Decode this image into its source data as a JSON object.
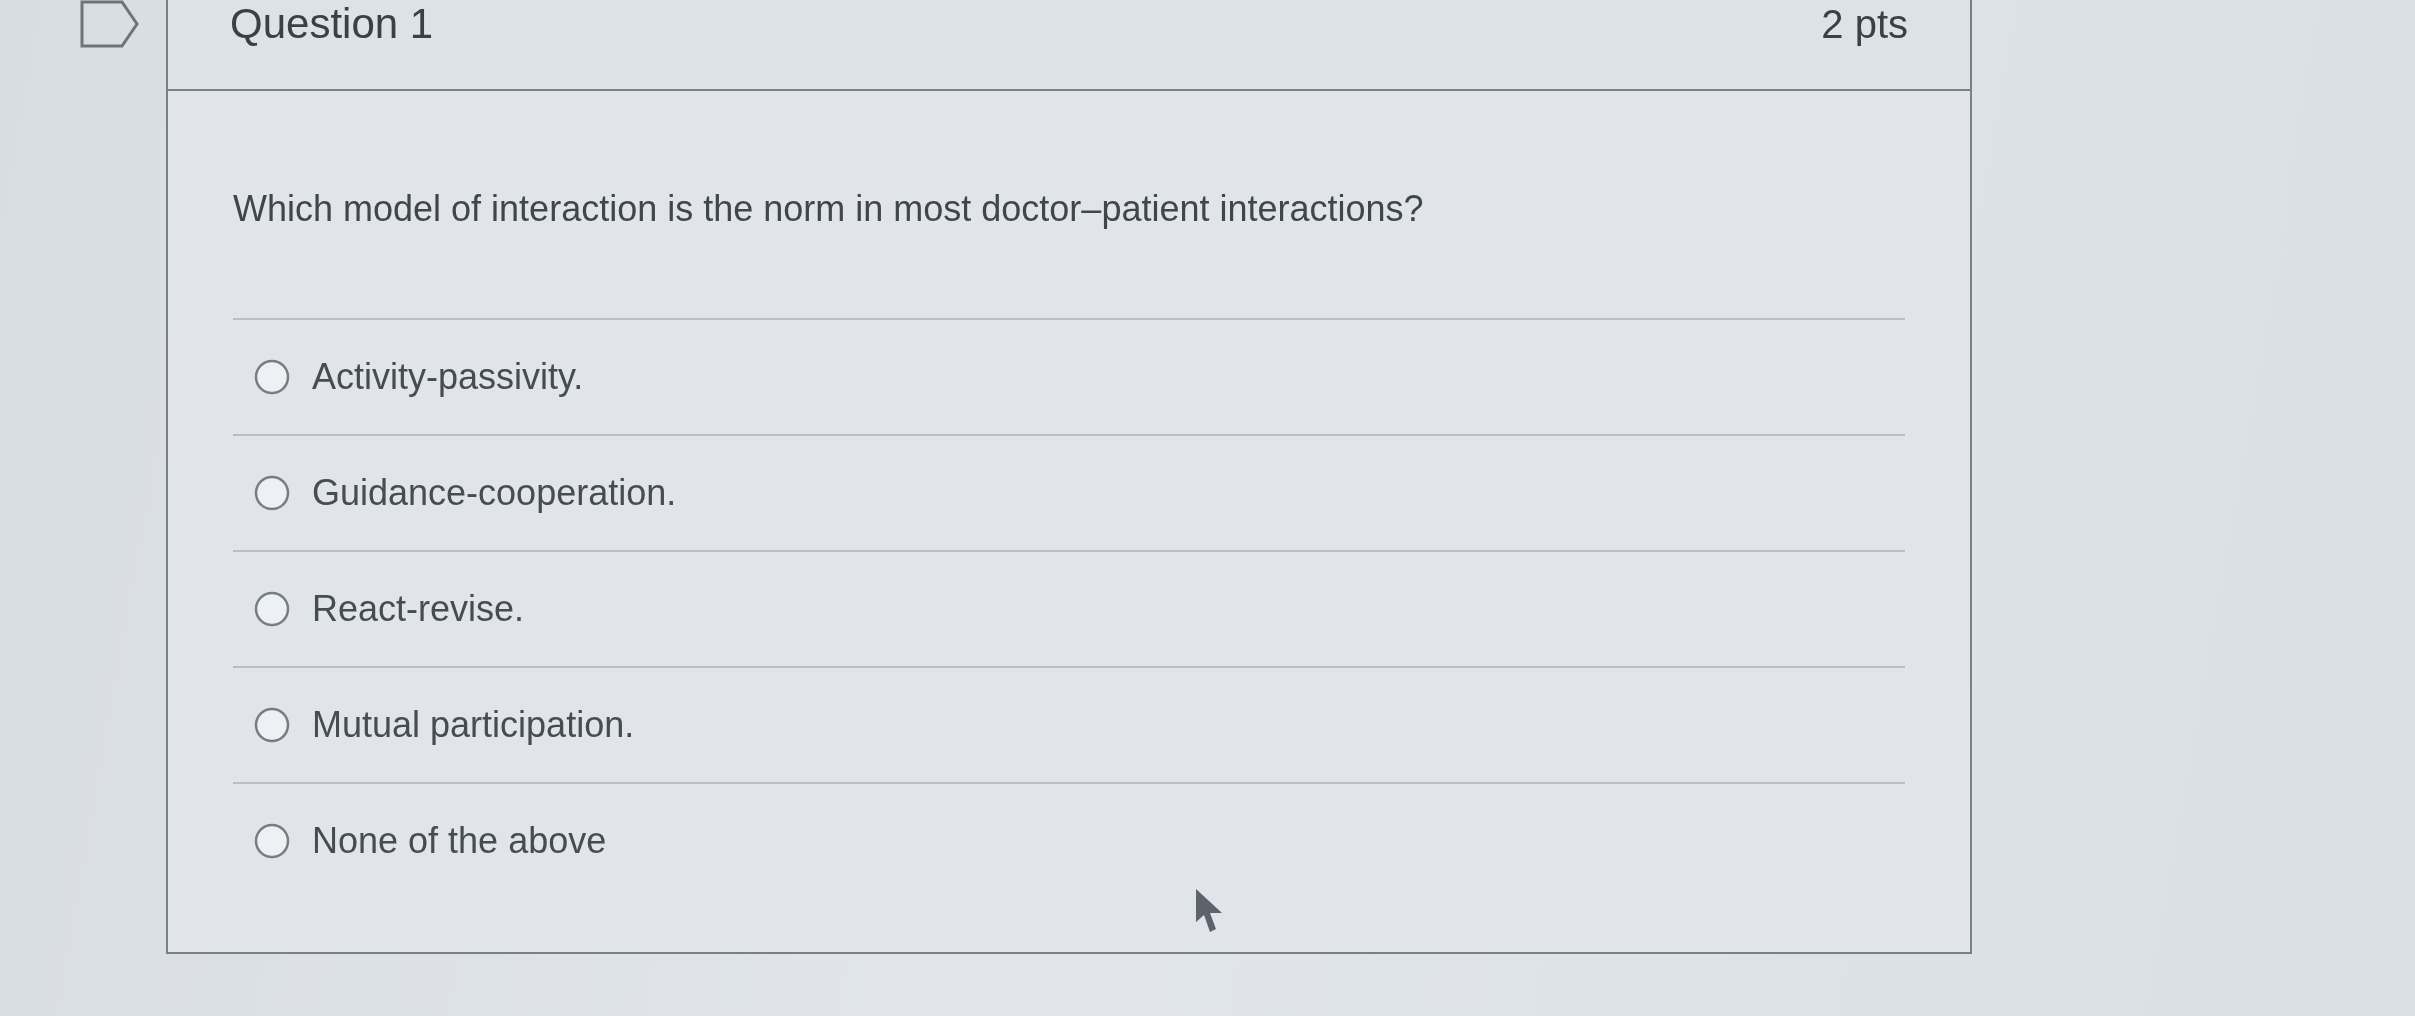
{
  "question": {
    "flagged": false,
    "title": "Question 1",
    "points": "2 pts",
    "text": "Which model of interaction is the norm in most doctor–patient interactions?",
    "answers": [
      {
        "label": "Activity-passivity.",
        "selected": false
      },
      {
        "label": "Guidance-cooperation.",
        "selected": false
      },
      {
        "label": "React-revise.",
        "selected": false
      },
      {
        "label": "Mutual participation.",
        "selected": false
      },
      {
        "label": "None of the above",
        "selected": false
      }
    ]
  }
}
